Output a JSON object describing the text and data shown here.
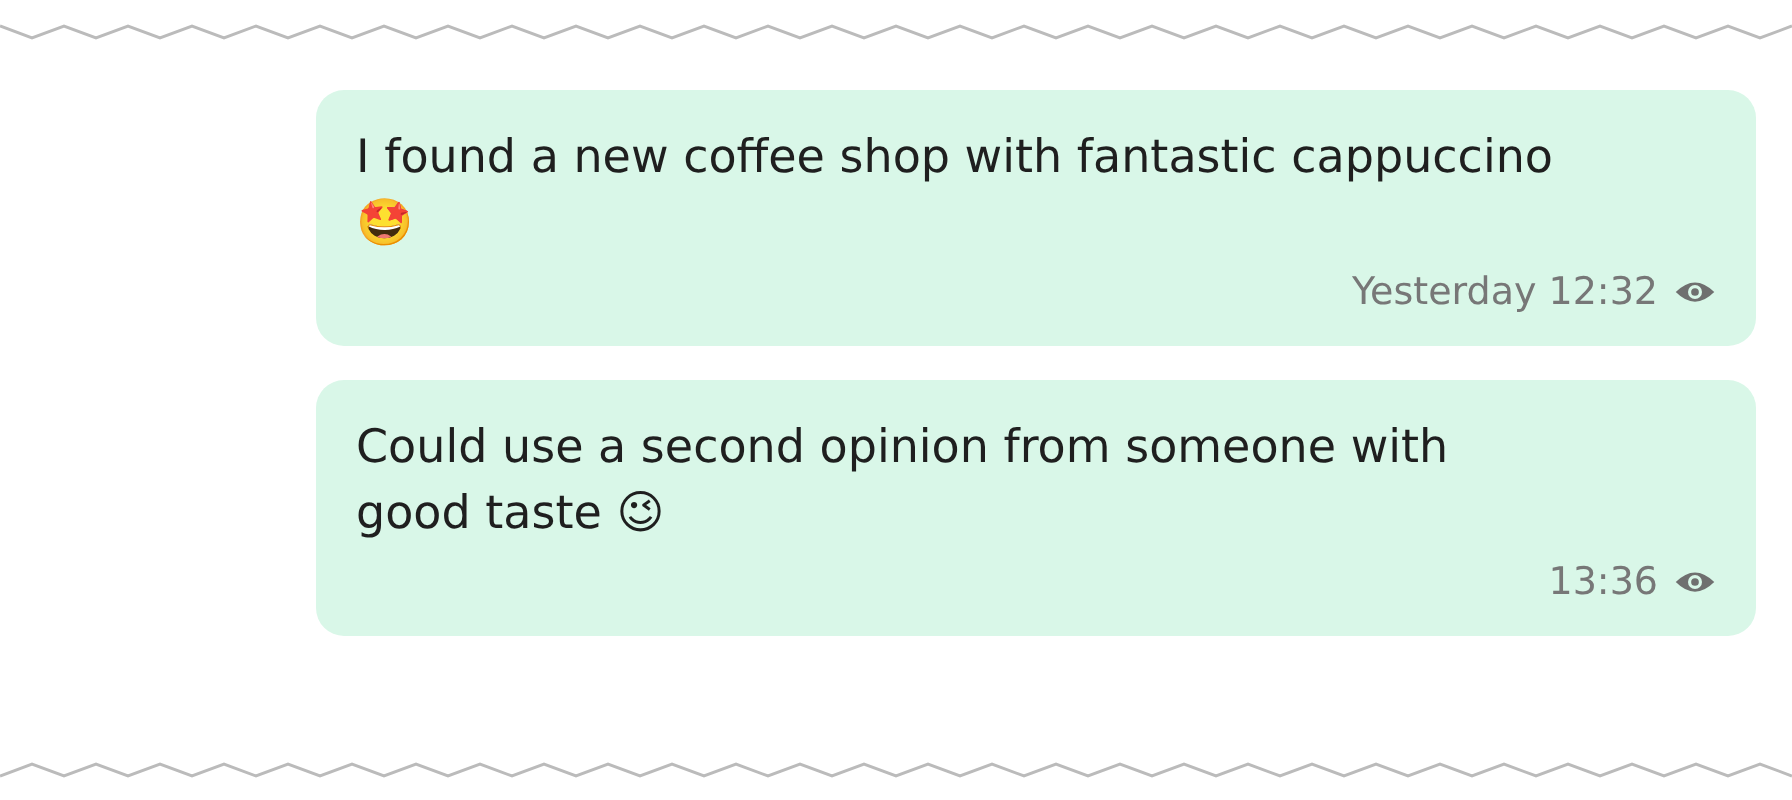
{
  "messages": [
    {
      "text": "I found a new coffee shop with fantastic cappuccino 🤩",
      "time": "Yesterday 12:32",
      "seen": true
    },
    {
      "text": "Could use a second opinion from someone with good taste 😉",
      "time": "13:36",
      "seen": true
    }
  ]
}
